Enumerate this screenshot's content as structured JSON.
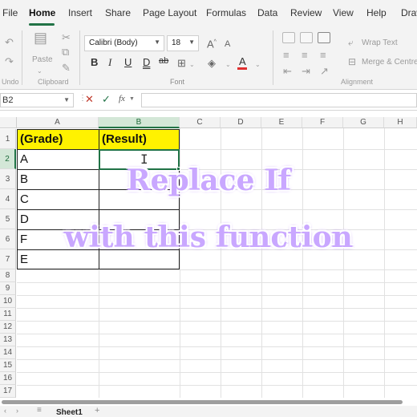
{
  "menu": {
    "tabs": [
      "File",
      "Home",
      "Insert",
      "Share",
      "Page Layout",
      "Formulas",
      "Data",
      "Review",
      "View",
      "Help",
      "Draw"
    ],
    "active": "Home"
  },
  "ribbon": {
    "undo_label": "Undo",
    "paste_label": "Paste",
    "clipboard_label": "Clipboard",
    "font_name": "Calibri (Body)",
    "font_size": "18",
    "font_label": "Font",
    "wrap_text_label": "Wrap Text",
    "merge_label": "Merge & Centre",
    "alignment_label": "Alignment",
    "bold": "B",
    "italic": "I",
    "underline": "U",
    "double_underline": "D",
    "strike": "ab",
    "font_color_hex": "#e03030"
  },
  "formula_bar": {
    "name_box": "B2",
    "cancel_icon": "✕",
    "enter_icon": "✓",
    "fx_label": "fx",
    "formula": ""
  },
  "grid": {
    "columns": [
      "A",
      "B",
      "C",
      "D",
      "E",
      "F",
      "G",
      "H"
    ],
    "rows": [
      "1",
      "2",
      "3",
      "4",
      "5",
      "6",
      "7",
      "8",
      "9",
      "10",
      "11",
      "12",
      "13",
      "14",
      "15",
      "16",
      "17"
    ],
    "selected_column": "B",
    "selected_row": "2",
    "header_fill_hex": "#fff200",
    "cells": {
      "A1": "(Grade)",
      "B1": "(Result)",
      "A2": "A",
      "A3": "B",
      "A4": "C",
      "A5": "D",
      "A6": "F",
      "A7": "E"
    }
  },
  "overlay": {
    "line1": "Replace If",
    "line2": "with this function",
    "color_hex": "#c9a7ff"
  },
  "sheets": {
    "active": "Sheet1",
    "add": "+"
  }
}
